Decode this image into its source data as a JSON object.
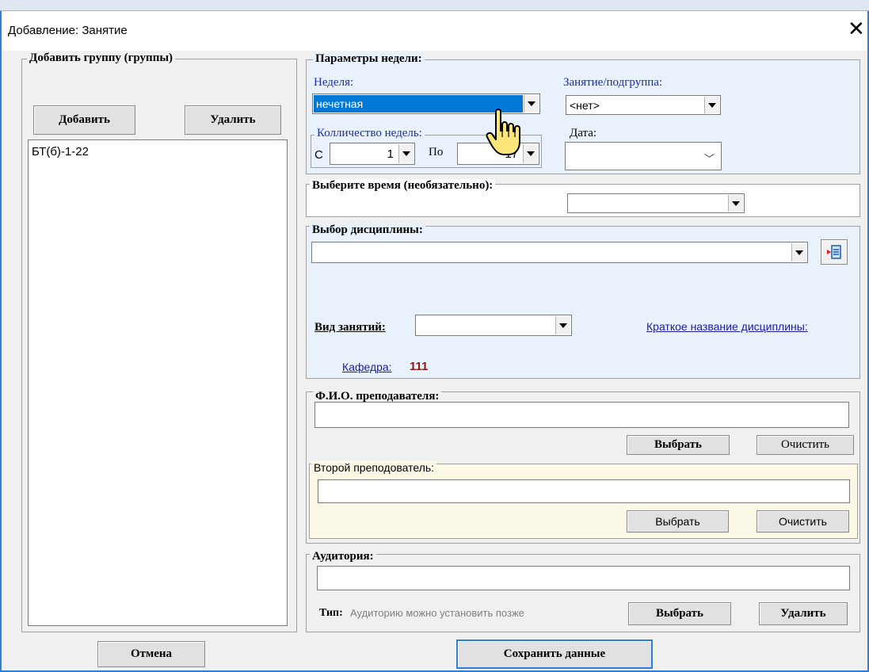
{
  "window": {
    "title": "Добавление: Занятие"
  },
  "groups_panel": {
    "title": "Добавить группу (группы)",
    "add_label": "Добавить",
    "remove_label": "Удалить",
    "items": [
      "БТ(б)-1-22"
    ]
  },
  "week_params": {
    "title": "Параметры недели:",
    "week_label": "Неделя:",
    "week_value": "нечетная",
    "lesson_label": "Занятие/подгруппа:",
    "lesson_value": "<нет>",
    "count_title": "Колличество недель:",
    "from_label": "С",
    "from_value": "1",
    "to_label": "По",
    "to_value": "17",
    "date_label": "Дата:",
    "date_value": ""
  },
  "time_section": {
    "title": "Выберите время (необязательно):",
    "value": ""
  },
  "discipline": {
    "title": "Выбор дисциплины:",
    "value": "",
    "lesson_type_label": "Вид занятий:",
    "lesson_type_value": "",
    "short_name_link": "Краткое название дисциплины:",
    "dept_label": "Кафедра:",
    "dept_value": "111",
    "dept_color": "#8b1a1a"
  },
  "teacher": {
    "title": "Ф.И.О. преподавателя:",
    "value": "",
    "select_label": "Выбрать",
    "clear_label": "Очистить",
    "second_title": "Второй преподователь:",
    "second_value": "",
    "second_select_label": "Выбрать",
    "second_clear_label": "Очистить"
  },
  "room": {
    "title": "Аудитория:",
    "value": "",
    "type_label": "Тип:",
    "type_hint": "Аудиторию можно установить позже",
    "select_label": "Выбрать",
    "remove_label": "Удалить"
  },
  "footer": {
    "cancel_label": "Отмена",
    "save_label": "Сохранить данные"
  },
  "colors": {
    "accent": "#2f7fd6",
    "selection": "#0078d7",
    "panel_blue": "#e9f2fb",
    "panel_cream": "#fbf8e6"
  },
  "icons": {
    "close": "close-icon",
    "dropdown": "chevron-down-icon",
    "picker": "list-picker-icon",
    "cursor": "hand-pointer-icon"
  }
}
